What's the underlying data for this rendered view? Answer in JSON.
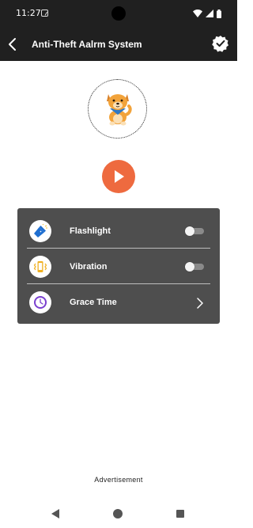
{
  "status_bar": {
    "time": "11:27"
  },
  "app_bar": {
    "title": "Anti-Theft Aalrm System"
  },
  "settings": [
    {
      "label": "Flashlight",
      "type": "toggle",
      "enabled": false
    },
    {
      "label": "Vibration",
      "type": "toggle",
      "enabled": false
    },
    {
      "label": "Grace Time",
      "type": "link"
    }
  ],
  "footer": {
    "ad_label": "Advertisement"
  },
  "colors": {
    "bar_background": "#202020",
    "accent_play": "#ee6a3f",
    "panel_background": "#4e4e4e"
  },
  "icons": {
    "mascot": "dog-icon",
    "play": "play-icon",
    "flashlight": "flashlight-icon",
    "vibration": "vibration-icon",
    "grace_time": "clock-icon"
  }
}
